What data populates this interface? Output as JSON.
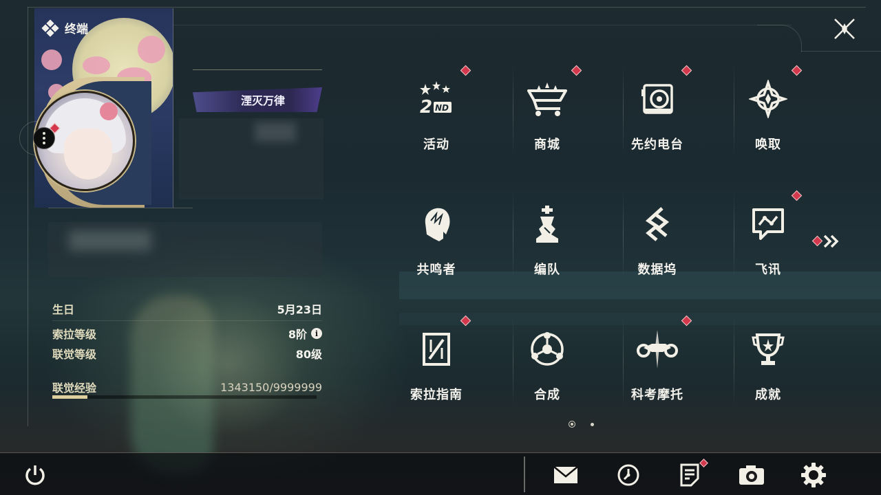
{
  "header": {
    "title": "终端"
  },
  "profile": {
    "title_badge": "湮灭万律",
    "rows": [
      {
        "label": "生日",
        "value": "5月23日"
      },
      {
        "label": "索拉等级",
        "value": "8阶"
      },
      {
        "label": "联觉等级",
        "value": "80级"
      },
      {
        "label": "联觉经验",
        "value": "1343150/9999999"
      }
    ],
    "exp_progress": 0.134
  },
  "menu": {
    "items": [
      {
        "label": "活动",
        "icon": "event-2nd-anniversary-icon",
        "badge": true
      },
      {
        "label": "商城",
        "icon": "shop-cart-icon",
        "badge": true
      },
      {
        "label": "先约电台",
        "icon": "radio-icon",
        "badge": true
      },
      {
        "label": "唤取",
        "icon": "convene-icon",
        "badge": true
      },
      {
        "label": "共鸣者",
        "icon": "resonator-head-icon",
        "badge": false
      },
      {
        "label": "编队",
        "icon": "chess-team-icon",
        "badge": false
      },
      {
        "label": "数据坞",
        "icon": "data-bank-icon",
        "badge": false
      },
      {
        "label": "飞讯",
        "icon": "chat-message-icon",
        "badge": true
      },
      {
        "label": "索拉指南",
        "icon": "guidebook-icon",
        "badge": true
      },
      {
        "label": "合成",
        "icon": "synthesis-icon",
        "badge": false
      },
      {
        "label": "科考摩托",
        "icon": "motorcycle-icon",
        "badge": true
      },
      {
        "label": "成就",
        "icon": "trophy-icon",
        "badge": false
      }
    ],
    "page_count": 2,
    "current_page": 1
  },
  "bottom_bar": {
    "icons": [
      "power-icon",
      "mail-icon",
      "clock-icon",
      "notice-icon",
      "camera-icon",
      "settings-gear-icon"
    ]
  },
  "colors": {
    "accent_gold": "#e0cf9e",
    "badge_red": "#d4384d",
    "background": "#1d2a30"
  }
}
